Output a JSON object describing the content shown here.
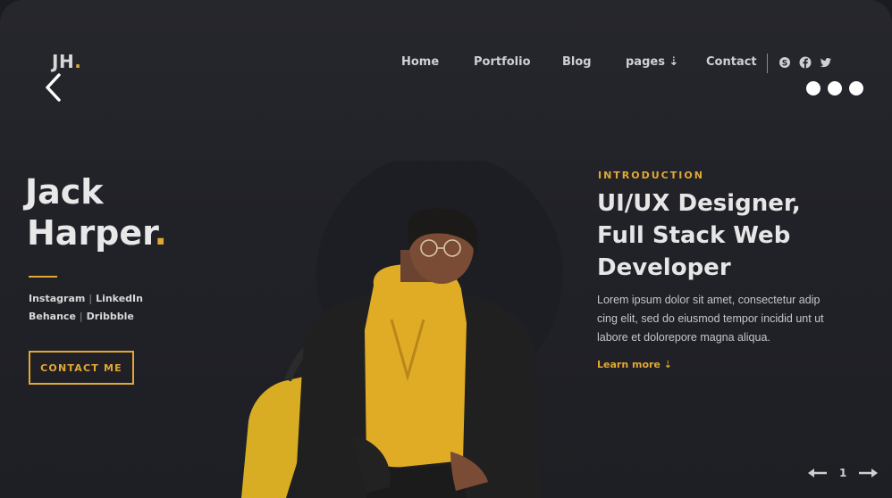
{
  "logo": {
    "text": "JH",
    "dot": "."
  },
  "nav": {
    "home": "Home",
    "portfolio": "Portfolio",
    "blog": "Blog",
    "pages": "pages ⇣",
    "contact": "Contact"
  },
  "social_icons": [
    "skype-icon",
    "facebook-icon",
    "twitter-icon"
  ],
  "hero": {
    "first_name": "Jack",
    "last_name": "Harper",
    "name_dot": ".",
    "links": {
      "instagram": "Instagram",
      "linkedin": "LinkedIn",
      "behance": "Behance",
      "dribbble": "Dribbble",
      "separator": "|"
    },
    "contact_button": "CONTACT ME"
  },
  "intro": {
    "label": "INTRODUCTION",
    "headline_lines": [
      "UI/UX Designer,",
      "Full Stack Web",
      "Developer"
    ],
    "description_lines": [
      "Lorem ipsum dolor sit amet, consectetur adip",
      "cing elit, sed do eiusmod tempor incidid unt ut",
      "labore et dolorepore magna aliqua."
    ],
    "learn_more": "Learn more ⇣"
  },
  "pager": {
    "page": "1"
  },
  "colors": {
    "accent": "#e3a833",
    "background": "#212228",
    "text": "#e6e6e6"
  }
}
